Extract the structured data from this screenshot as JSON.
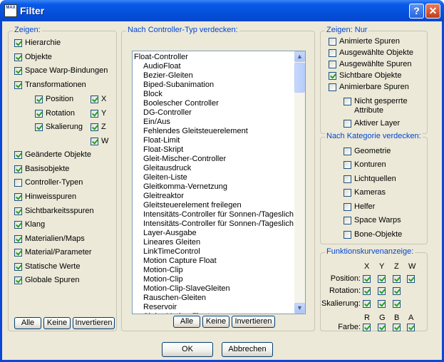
{
  "window": {
    "title": "Filter",
    "icon_text": "MAX",
    "help_glyph": "?",
    "close_glyph": "✕"
  },
  "zeigen": {
    "legend": "Zeigen:",
    "items": [
      {
        "label": "Hierarchie",
        "checked": true
      },
      {
        "label": "Objekte",
        "checked": true
      },
      {
        "label": "Space Warp-Bindungen",
        "checked": true
      },
      {
        "label": "Transformationen",
        "checked": true
      }
    ],
    "transform_sub": [
      {
        "label": "Position",
        "checked": true
      },
      {
        "label": "Rotation",
        "checked": true
      },
      {
        "label": "Skalierung",
        "checked": true
      }
    ],
    "axes": [
      {
        "label": "X",
        "checked": true
      },
      {
        "label": "Y",
        "checked": true
      },
      {
        "label": "Z",
        "checked": true
      },
      {
        "label": "W",
        "checked": true
      }
    ],
    "items2": [
      {
        "label": "Geänderte Objekte",
        "checked": true
      },
      {
        "label": "Basisobjekte",
        "checked": true
      },
      {
        "label": "Controller-Typen",
        "checked": false
      },
      {
        "label": "Hinweisspuren",
        "checked": true
      },
      {
        "label": "Sichtbarkeitsspuren",
        "checked": true
      },
      {
        "label": "Klang",
        "checked": true
      },
      {
        "label": "Materialien/Maps",
        "checked": true
      },
      {
        "label": "Material/Parameter",
        "checked": true
      },
      {
        "label": "Statische Werte",
        "checked": true
      },
      {
        "label": "Globale Spuren",
        "checked": true
      }
    ],
    "buttons": {
      "all": "Alle",
      "none": "Keine",
      "invert": "Invertieren"
    }
  },
  "controller": {
    "legend": "Nach Controller-Typ verdecken:",
    "items": [
      {
        "label": "Float-Controller",
        "indent": false
      },
      {
        "label": "AudioFloat",
        "indent": true
      },
      {
        "label": "Bezier-Gleiten",
        "indent": true
      },
      {
        "label": "Biped-Subanimation",
        "indent": true
      },
      {
        "label": "Block",
        "indent": true
      },
      {
        "label": "Boolescher Controller",
        "indent": true
      },
      {
        "label": "DG-Controller",
        "indent": true
      },
      {
        "label": "Ein/Aus",
        "indent": true
      },
      {
        "label": "Fehlendes Gleitsteuerelement",
        "indent": true
      },
      {
        "label": "Float-Limit",
        "indent": true
      },
      {
        "label": "Float-Skript",
        "indent": true
      },
      {
        "label": "Gleit-Mischer-Controller",
        "indent": true
      },
      {
        "label": "Gleitausdruck",
        "indent": true
      },
      {
        "label": "Gleiten-Liste",
        "indent": true
      },
      {
        "label": "Gleitkomma-Vernetzung",
        "indent": true
      },
      {
        "label": "Gleitreaktor",
        "indent": true
      },
      {
        "label": "Gleitsteuerelement freilegen",
        "indent": true
      },
      {
        "label": "Intensitäts-Controller für Sonnen-/Tageslich",
        "indent": true
      },
      {
        "label": "Intensitäts-Controller für Sonnen-/Tageslich",
        "indent": true
      },
      {
        "label": "Layer-Ausgabe",
        "indent": true
      },
      {
        "label": "Lineares Gleiten",
        "indent": true
      },
      {
        "label": "LinkTimeControl",
        "indent": true
      },
      {
        "label": "Motion Capture Float",
        "indent": true
      },
      {
        "label": "Motion-Clip",
        "indent": true
      },
      {
        "label": "Motion-Clip",
        "indent": true
      },
      {
        "label": "Motion-Clip-SlaveGleiten",
        "indent": true
      },
      {
        "label": "Rauschen-Gleiten",
        "indent": true
      },
      {
        "label": "Reservoir",
        "indent": true
      },
      {
        "label": "Skript-Motion-Float",
        "indent": true
      }
    ],
    "buttons": {
      "all": "Alle",
      "none": "Keine",
      "invert": "Invertieren"
    }
  },
  "nur": {
    "legend": "Zeigen: Nur",
    "items": [
      {
        "label": "Animierte Spuren",
        "checked": false
      },
      {
        "label": "Ausgewählte Objekte",
        "checked": false
      },
      {
        "label": "Ausgewählte Spuren",
        "checked": false
      },
      {
        "label": "Sichtbare Objekte",
        "checked": true
      },
      {
        "label": "Animierbare Spuren",
        "checked": false
      }
    ],
    "sub": [
      {
        "label1": "Nicht gesperrte",
        "label2": "Attribute",
        "checked": false
      },
      {
        "label1": "Aktiver Layer",
        "label2": "",
        "checked": false
      }
    ]
  },
  "kategorie": {
    "legend": "Nach Kategorie verdecken:",
    "items": [
      {
        "label": "Geometrie",
        "checked": false
      },
      {
        "label": "Konturen",
        "checked": false
      },
      {
        "label": "Lichtquellen",
        "checked": false
      },
      {
        "label": "Kameras",
        "checked": false
      },
      {
        "label": "Helfer",
        "checked": false
      },
      {
        "label": "Space Warps",
        "checked": false
      },
      {
        "label": "Bone-Objekte",
        "checked": false
      }
    ]
  },
  "kurven": {
    "legend": "Funktionskurvenanzeige:",
    "axis_headers": [
      "X",
      "Y",
      "Z",
      "W"
    ],
    "rows": [
      {
        "label": "Position:",
        "checked": [
          true,
          true,
          true,
          true
        ]
      },
      {
        "label": "Rotation:",
        "checked": [
          true,
          true,
          true
        ]
      },
      {
        "label": "Skalierung:",
        "checked": [
          true,
          true,
          true
        ]
      }
    ],
    "color_headers": [
      "R",
      "G",
      "B",
      "A"
    ],
    "color_row": {
      "label": "Farbe:",
      "checked": [
        true,
        true,
        true,
        true
      ]
    }
  },
  "footer": {
    "ok": "OK",
    "cancel": "Abbrechen"
  }
}
